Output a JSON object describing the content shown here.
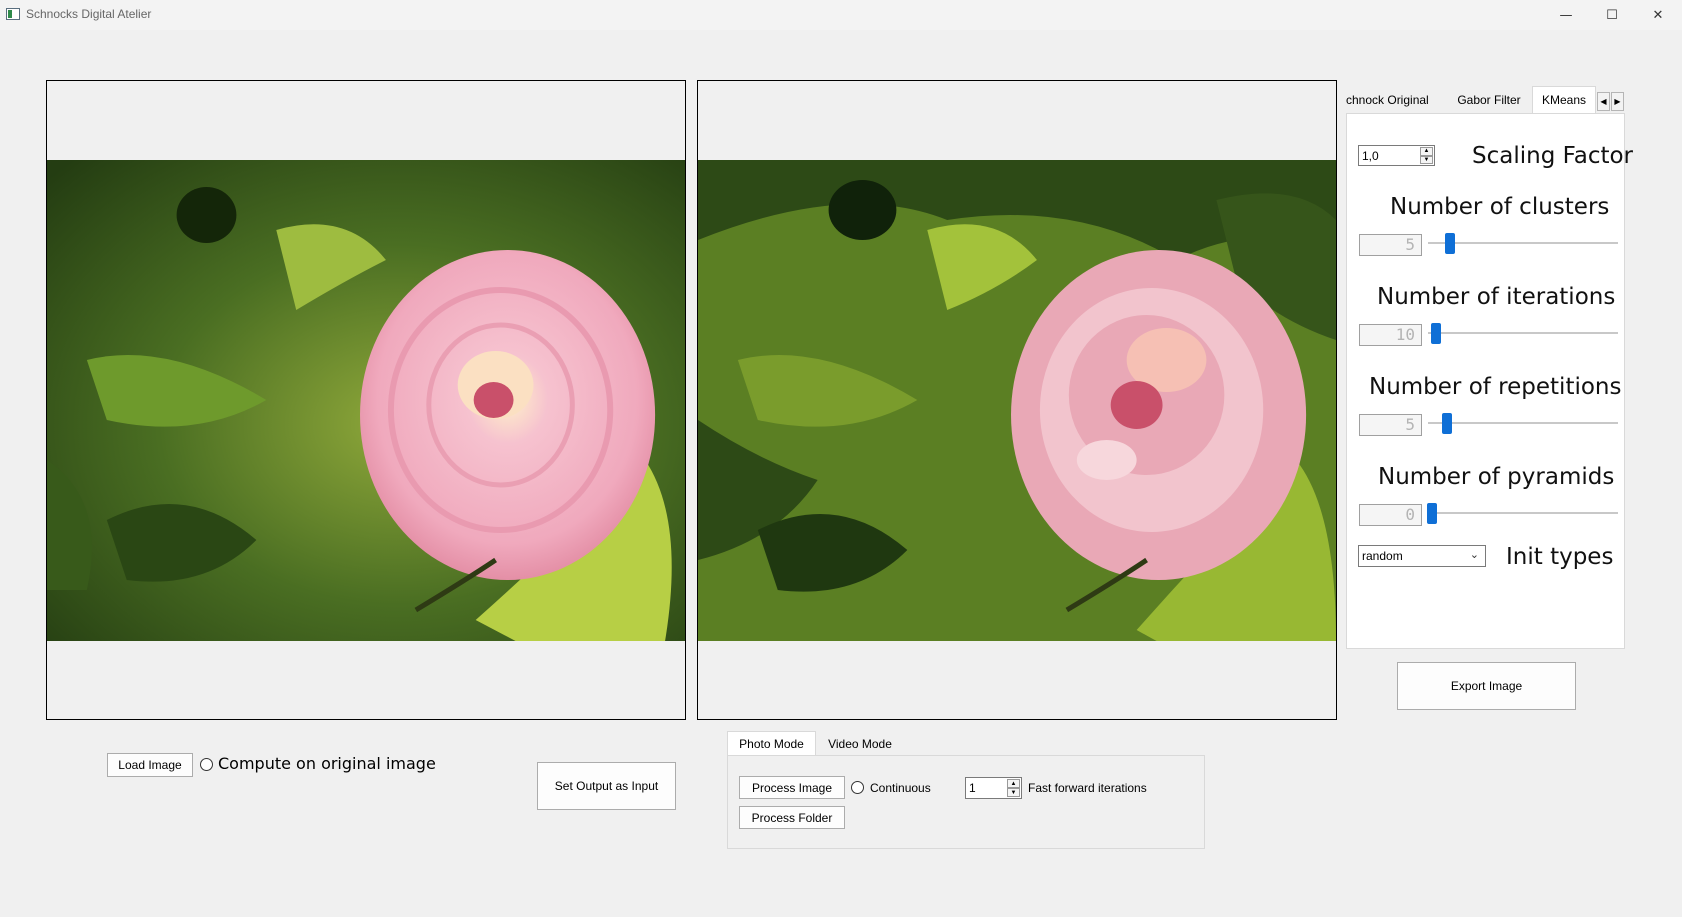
{
  "window": {
    "title": "Schnocks Digital Atelier",
    "minimize_glyph": "—",
    "maximize_glyph": "☐",
    "close_glyph": "✕"
  },
  "images": {
    "input_alt": "input image",
    "output_alt": "output image"
  },
  "tabs": {
    "items": [
      "chnock Original",
      "Gabor Filter",
      "KMeans"
    ],
    "active": "KMeans",
    "scroll_left": "◀",
    "scroll_right": "▶"
  },
  "kmeans": {
    "scaling_factor_value": "1,0",
    "scaling_factor_label": "Scaling Factor",
    "clusters_label": "Number of clusters",
    "clusters_value": "5",
    "iterations_label": "Number of iterations",
    "iterations_value": "10",
    "repetitions_label": "Number of repetitions",
    "repetitions_value": "5",
    "pyramids_label": "Number of pyramids",
    "pyramids_value": "0",
    "slider_levels": {
      "clusters": 0.08,
      "iterations": 0.01,
      "repetitions": 0.07,
      "pyramids": 0.0
    },
    "init_type_value": "random",
    "init_types_label": "Init types"
  },
  "actions": {
    "export_image": "Export Image",
    "load_image": "Load Image",
    "compute_on_original": "Compute on original image",
    "set_output_as_input": "Set Output as Input"
  },
  "mode": {
    "tabs": [
      "Photo Mode",
      "Video Mode"
    ],
    "active": "Photo Mode",
    "process_image": "Process Image",
    "continuous": "Continuous",
    "fast_forward_value": "1",
    "fast_forward_label": "Fast forward iterations",
    "process_folder": "Process Folder"
  },
  "colors": {
    "accent": "#0f6fd6",
    "leaf_dark": "#2d4a16",
    "leaf_mid": "#5b7f23",
    "leaf_light": "#a3c23b",
    "petal_pink": "#f2b8c6",
    "petal_deep": "#c9506a"
  }
}
